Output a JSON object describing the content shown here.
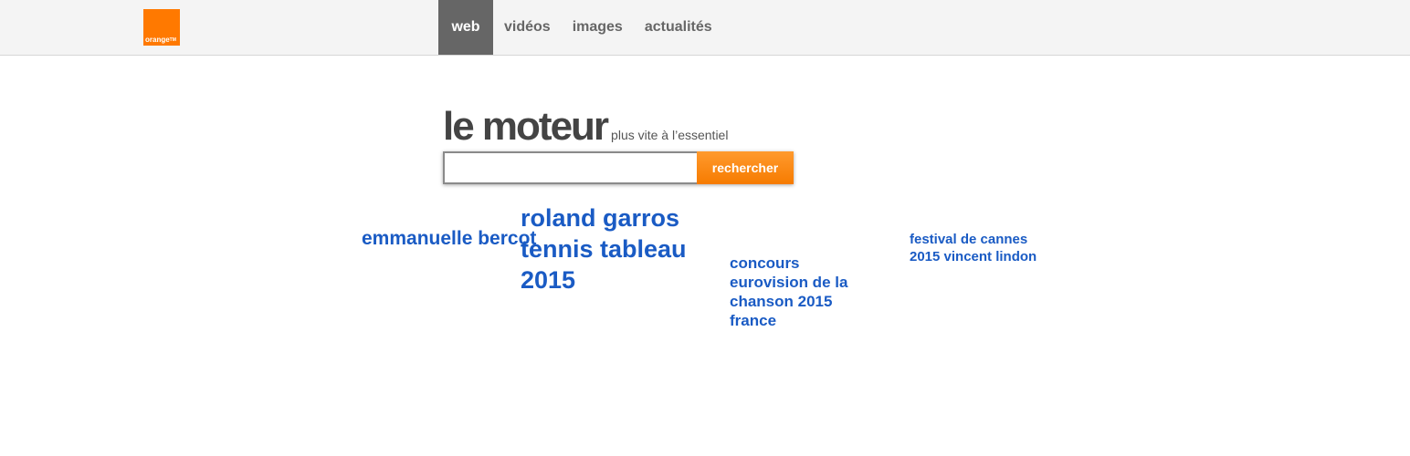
{
  "header": {
    "logo_text": "orange",
    "logo_tm": "TM",
    "tabs": [
      {
        "label": "web",
        "active": true
      },
      {
        "label": "vidéos",
        "active": false
      },
      {
        "label": "images",
        "active": false
      },
      {
        "label": "actualités",
        "active": false
      }
    ]
  },
  "brand": {
    "title": "le moteur",
    "tagline": "plus vite à l’essentiel"
  },
  "search": {
    "value": "",
    "button_label": "rechercher"
  },
  "trending": [
    {
      "label": "emmanuelle bercot"
    },
    {
      "label": "roland garros tennis tableau 2015"
    },
    {
      "label": "concours eurovision de la chanson 2015 france"
    },
    {
      "label": "festival de cannes 2015 vincent lindon"
    }
  ],
  "colors": {
    "brand_orange": "#ff7900",
    "link_blue": "#1a5bc4",
    "active_tab_bg": "#666666"
  }
}
